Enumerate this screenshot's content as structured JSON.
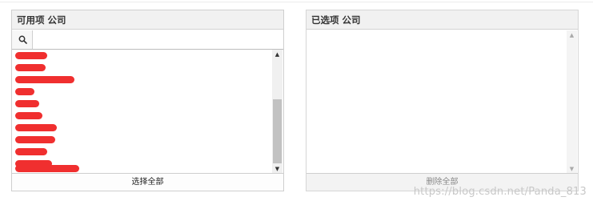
{
  "available": {
    "title": "可用项 公司",
    "search_placeholder": "",
    "items": [
      "",
      "",
      "",
      "",
      "",
      "",
      "",
      "",
      "",
      "",
      ""
    ],
    "select_all_label": "选择全部"
  },
  "selected": {
    "title": "已选项 公司",
    "remove_all_label": "删除全部"
  },
  "watermark": "https://blog.csdn.net/Panda_813",
  "colors": {
    "redaction": "#f02f2f",
    "header_bg": "#f1f1f1",
    "scroll_thumb": "#c2c2c2"
  }
}
